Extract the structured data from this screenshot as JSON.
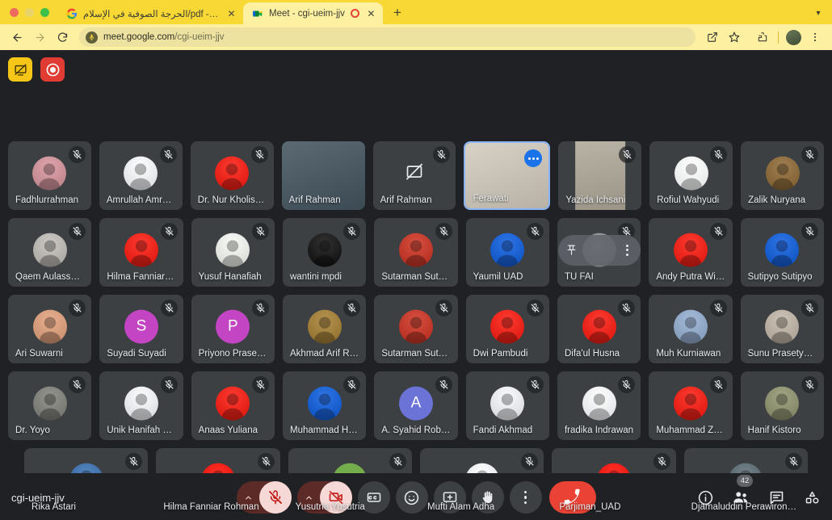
{
  "browser": {
    "tabs": [
      {
        "title": "الحرجة الصوفية في الإسلام/pdf - P...",
        "favicon": "google-g-icon",
        "active": false,
        "recording": false
      },
      {
        "title": "Meet - cgi-ueim-jjv",
        "favicon": "meet-icon",
        "active": true,
        "recording": true
      }
    ],
    "new_tab_label": "+",
    "window_chevron": "▾",
    "nav": {
      "back": "←",
      "forward": "→",
      "reload": "⟳"
    },
    "omnibox": {
      "url_host": "meet.google.com",
      "url_path": "/cgi-ueim-jjv"
    },
    "toolbar_right": [
      "share-icon",
      "bookmark-star-icon",
      "extensions-icon",
      "profile-avatar",
      "chrome-menu-icon"
    ]
  },
  "meet": {
    "meeting_code": "cgi-ueim-jjv",
    "top_buttons": [
      {
        "name": "presentation-blocked-button",
        "color": "#f5c518"
      },
      {
        "name": "recording-button",
        "color": "#e03c33"
      }
    ],
    "rows": [
      {
        "tiles": [
          {
            "name": "Fadhlurrahman",
            "type": "photo",
            "av_bg": "#c98f96",
            "muted": true
          },
          {
            "name": "Amrullah Amrul...",
            "type": "photo",
            "av_bg": "#e8eaed",
            "muted": true
          },
          {
            "name": "Dr. Nur Kholis, ...",
            "type": "photo",
            "av_bg": "#e8241b",
            "muted": true
          },
          {
            "name": "Arif Rahman",
            "type": "video",
            "video_bg": "#5c6a74",
            "muted": false
          },
          {
            "name": "Arif Rahman",
            "type": "noshare",
            "muted": true
          },
          {
            "name": "Ferawati",
            "type": "video",
            "video_bg": "#d8d2c6",
            "muted": false,
            "focused": true,
            "menu": true
          },
          {
            "name": "Yazida Ichsani",
            "type": "video-narrow",
            "video_bg": "#b9b3a6",
            "muted": true
          },
          {
            "name": "Rofiul Wahyudi",
            "type": "photo",
            "av_bg": "#f1f3f4",
            "muted": true
          },
          {
            "name": "Zalik Nuryana",
            "type": "photo",
            "av_bg": "#8a6a3c",
            "muted": true
          }
        ]
      },
      {
        "tiles": [
          {
            "name": "Qaem Aulassya...",
            "type": "photo",
            "av_bg": "#b6b3ae",
            "muted": true
          },
          {
            "name": "Hilma Fanniar R...",
            "type": "photo",
            "av_bg": "#e8241b",
            "muted": true
          },
          {
            "name": "Yusuf Hanafiah",
            "type": "photo",
            "av_bg": "#e4e6e1",
            "muted": true
          },
          {
            "name": "wantini mpdi",
            "type": "photo",
            "av_bg": "#1c1c1c",
            "muted": true
          },
          {
            "name": "Sutarman Suta...",
            "type": "photo",
            "av_bg": "#c0392b",
            "muted": true
          },
          {
            "name": "Yaumil UAD",
            "type": "photo",
            "av_bg": "#1a5fd0",
            "muted": true
          },
          {
            "name": "TU FAI",
            "type": "hover",
            "av_bg": "#8a8d91",
            "muted": true,
            "pin": true
          },
          {
            "name": "Andy Putra Wij...",
            "type": "photo",
            "av_bg": "#e8241b",
            "muted": true
          },
          {
            "name": "Sutipyo Sutipyo",
            "type": "photo",
            "av_bg": "#1a5fd0",
            "muted": true
          }
        ]
      },
      {
        "tiles": [
          {
            "name": "Ari Suwarni",
            "type": "photo",
            "av_bg": "#d39a7a",
            "muted": true
          },
          {
            "name": "Suyadi Suyadi",
            "type": "letter",
            "letter": "S",
            "av_bg": "#c445c4",
            "muted": true
          },
          {
            "name": "Priyono Prasetyo",
            "type": "letter",
            "letter": "P",
            "av_bg": "#c445c4",
            "muted": true
          },
          {
            "name": "Akhmad Arif Ri...",
            "type": "photo",
            "av_bg": "#9e7c3a",
            "muted": true
          },
          {
            "name": "Sutarman Suta...",
            "type": "photo",
            "av_bg": "#c0392b",
            "muted": true
          },
          {
            "name": "Dwi Pambudi",
            "type": "photo",
            "av_bg": "#e8241b",
            "muted": true
          },
          {
            "name": "Difa'ul Husna",
            "type": "photo",
            "av_bg": "#e8241b",
            "muted": true
          },
          {
            "name": "Muh Kurniawan",
            "type": "photo",
            "av_bg": "#8fa5c4",
            "muted": true
          },
          {
            "name": "Sunu Prasetya ...",
            "type": "photo",
            "av_bg": "#b6ada0",
            "muted": true
          }
        ]
      },
      {
        "tiles": [
          {
            "name": "Dr. Yoyo",
            "type": "photo",
            "av_bg": "#7d7f78",
            "muted": true
          },
          {
            "name": "Unik Hanifah Sa...",
            "type": "photo",
            "av_bg": "#e6e7ea",
            "muted": true
          },
          {
            "name": "Anaas Yuliana",
            "type": "photo",
            "av_bg": "#e8241b",
            "muted": true
          },
          {
            "name": "Muhammad Ha...",
            "type": "photo",
            "av_bg": "#1a5fd0",
            "muted": true
          },
          {
            "name": "A. Syahid Robb...",
            "type": "letter",
            "letter": "A",
            "av_bg": "#6b73d6",
            "muted": true
          },
          {
            "name": "Fandi Akhmad",
            "type": "photo",
            "av_bg": "#e3e5e8",
            "muted": true
          },
          {
            "name": "fradika Indrawan",
            "type": "photo",
            "av_bg": "#eceef0",
            "muted": true
          },
          {
            "name": "Muhammad Za...",
            "type": "photo",
            "av_bg": "#e8241b",
            "muted": true
          },
          {
            "name": "Hanif Kistoro",
            "type": "photo",
            "av_bg": "#8c8f6e",
            "muted": true
          }
        ]
      },
      {
        "tiles": [
          {
            "name": "Rika Astari",
            "type": "photo",
            "av_bg": "#3f6fa8",
            "muted": true
          },
          {
            "name": "Hilma Fanniar Rohman",
            "type": "photo",
            "av_bg": "#f21a13",
            "muted": true
          },
          {
            "name": "Yusutria Yusutria",
            "type": "letter",
            "letter": "Y",
            "av_bg": "#74ad4c",
            "muted": true
          },
          {
            "name": "Mufti Alam Adha",
            "type": "photo",
            "av_bg": "#e8eaed",
            "muted": true
          },
          {
            "name": "Parjiman_UAD",
            "type": "photo",
            "av_bg": "#f21a13",
            "muted": true
          },
          {
            "name": "Djamaluddin Perawironeg...",
            "type": "photo",
            "av_bg": "#5d6b73",
            "muted": true
          }
        ]
      }
    ],
    "controls": {
      "mic": {
        "label": "microphone-off",
        "expand": "chevron-up"
      },
      "camera": {
        "label": "camera-off",
        "expand": "chevron-up"
      },
      "captions": "captions-button",
      "emoji": "emoji-reactions-button",
      "present": "present-screen-button",
      "raise_hand": "raise-hand-button",
      "more": "more-options-button",
      "end_call": "leave-call-button"
    },
    "right_controls": {
      "info": "meeting-details-button",
      "people": "show-everyone-button",
      "people_count": "42",
      "chat": "chat-button",
      "activities": "activities-button"
    }
  }
}
